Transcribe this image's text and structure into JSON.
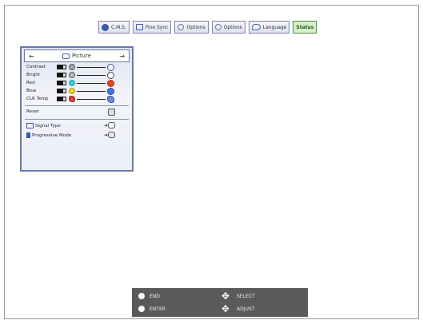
{
  "tabs": [
    {
      "label": "C.M.S.",
      "icon": "color-circle-icon"
    },
    {
      "label": "Fine Sync",
      "icon": "monitor-icon"
    },
    {
      "label": "Options",
      "icon": "options-ring-icon"
    },
    {
      "label": "Options",
      "icon": "options-ring-icon"
    },
    {
      "label": "Language",
      "icon": "speech-bubble-icon"
    },
    {
      "label": "Status",
      "icon": ""
    }
  ],
  "panel": {
    "title": "Picture",
    "prev_arrow": "←",
    "next_arrow": "→",
    "rows": [
      {
        "label": "Contrast"
      },
      {
        "label": "Bright"
      },
      {
        "label": "Red"
      },
      {
        "label": "Blue"
      },
      {
        "label": "CLR Temp"
      }
    ],
    "reset_label": "Reset",
    "signal_type_label": "Signal Type",
    "progressive_label": "Progressive Mode"
  },
  "guide": {
    "end": "END",
    "enter": "ENTER",
    "select": "SELECT",
    "adjust": "ADJUST"
  },
  "colors": {
    "accent": "#3a5aa8",
    "active_tab": "#d8f0c8",
    "guide_bg": "#5a5a5a"
  }
}
